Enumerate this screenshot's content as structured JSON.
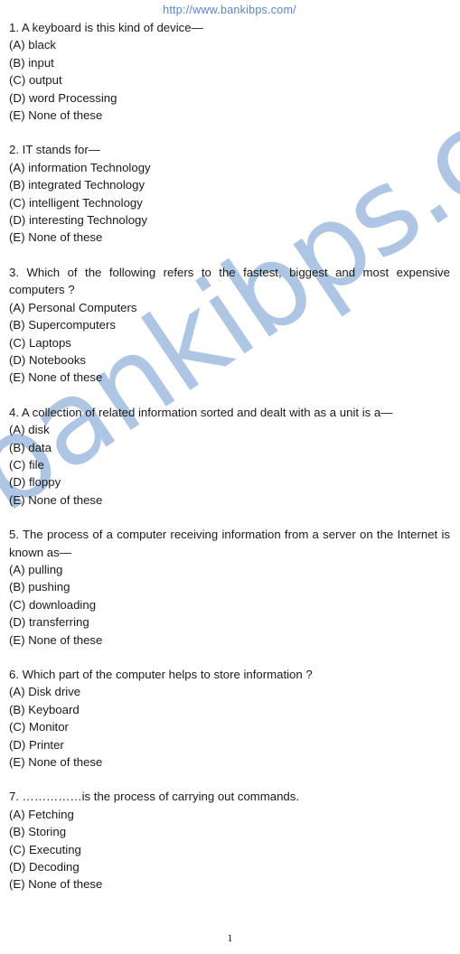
{
  "header": {
    "site_url": "http://www.bankibps.com/"
  },
  "watermark": {
    "text": "bankibps.com",
    "color": "#aec6e3",
    "rotation_deg": -34
  },
  "colors": {
    "site_url": "#5b85c8",
    "body_text": "#1a1a1a",
    "page_background": "#ffffff",
    "watermark": "#aec6e3"
  },
  "footer": {
    "page_number": "1"
  },
  "questions": [
    {
      "number": "1.",
      "stem": "1. A keyboard is this kind of device—",
      "justified": false,
      "options": [
        "(A) black",
        "(B) input",
        "(C) output",
        "(D) word Processing",
        "(E) None of these"
      ]
    },
    {
      "number": "2.",
      "stem": "2. IT stands for—",
      "justified": false,
      "options": [
        "(A) information Technology",
        "(B) integrated Technology",
        "(C) intelligent Technology",
        "(D) interesting Technology",
        "(E) None of these"
      ]
    },
    {
      "number": "3.",
      "stem": "3. Which of the following refers to the fastest, biggest and most expensive computers ?",
      "justified": true,
      "options": [
        "(A) Personal Computers",
        "(B) Supercomputers",
        "(C) Laptops",
        "(D) Notebooks",
        "(E) None of these"
      ]
    },
    {
      "number": "4.",
      "stem": "4. A collection of related information sorted and dealt with as a unit is a—",
      "justified": false,
      "options": [
        "(A) disk",
        "(B) data",
        "(C) file",
        "(D) floppy",
        "(E) None of these"
      ]
    },
    {
      "number": "5.",
      "stem": "5. The process of a computer receiving information from a server on the Internet is known as—",
      "justified": true,
      "options": [
        "(A) pulling",
        "(B) pushing",
        "(C) downloading",
        "(D) transferring",
        "(E) None of these"
      ]
    },
    {
      "number": "6.",
      "stem": "6. Which part of the computer helps to store information ?",
      "justified": false,
      "options": [
        "(A) Disk drive",
        "(B) Keyboard",
        "(C) Monitor",
        "(D) Printer",
        "(E) None of these"
      ]
    },
    {
      "number": "7.",
      "stem": "7. ……………is the process of carrying out commands.",
      "justified": false,
      "options": [
        "(A) Fetching",
        "(B) Storing",
        "(C) Executing",
        "(D) Decoding",
        "(E) None of these"
      ]
    }
  ]
}
